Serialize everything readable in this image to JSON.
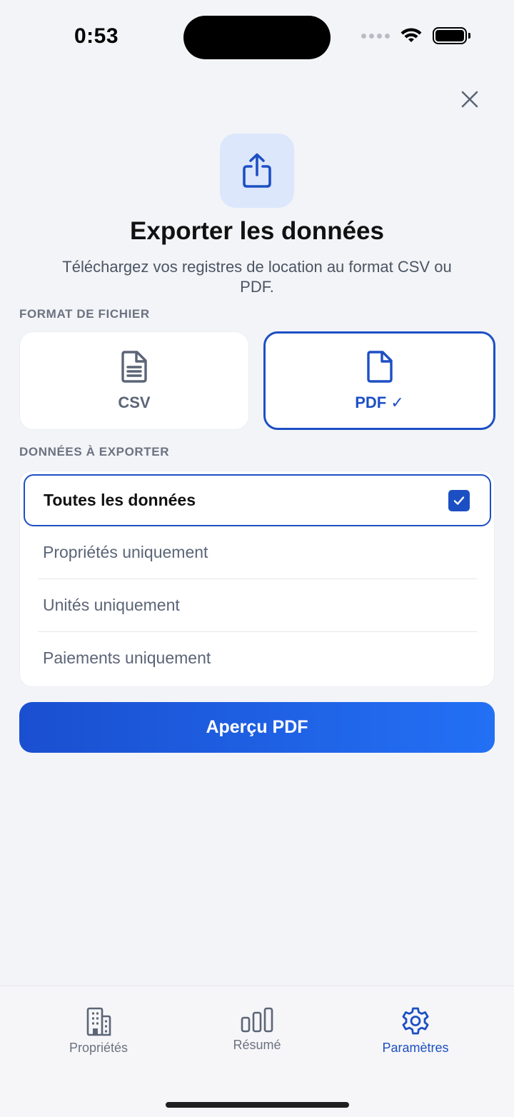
{
  "status": {
    "time": "0:53"
  },
  "header": {
    "title": "Exporter les données",
    "subtitle": "Téléchargez vos registres de location au format CSV ou PDF."
  },
  "format": {
    "section_label": "FORMAT DE FICHIER",
    "csv_label": "CSV",
    "pdf_label": "PDF ✓",
    "selected": "PDF"
  },
  "data_scope": {
    "section_label": "DONNÉES À EXPORTER",
    "options": [
      {
        "label": "Toutes les données",
        "selected": true
      },
      {
        "label": "Propriétés uniquement",
        "selected": false
      },
      {
        "label": "Unités uniquement",
        "selected": false
      },
      {
        "label": "Paiements uniquement",
        "selected": false
      }
    ]
  },
  "action": {
    "preview_label": "Aperçu PDF"
  },
  "tabbar": {
    "items": [
      {
        "label": "Propriétés",
        "icon": "building-icon",
        "active": false
      },
      {
        "label": "Résumé",
        "icon": "bar-chart-icon",
        "active": false
      },
      {
        "label": "Paramètres",
        "icon": "gear-icon",
        "active": true
      }
    ]
  },
  "colors": {
    "accent": "#1D4FC4",
    "background": "#F3F4F7",
    "icon_tile": "#DCE7FC",
    "muted_text": "#5B6577"
  }
}
